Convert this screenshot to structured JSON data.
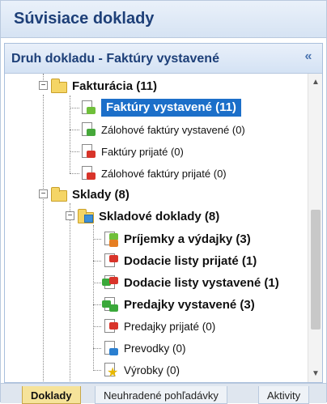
{
  "panel": {
    "title": "Súvisiace doklady"
  },
  "group": {
    "label": "Druh dokladu - Faktúry vystavené",
    "collapse_icon": "«"
  },
  "tree": {
    "fakturacia": {
      "label": "Fakturácia (11)",
      "items": [
        {
          "label": "Faktúry vystavené (11)",
          "selected": true
        },
        {
          "label": "Zálohové faktúry vystavené (0)"
        },
        {
          "label": "Faktúry prijaté (0)"
        },
        {
          "label": "Zálohové faktúry prijaté (0)"
        }
      ]
    },
    "sklady": {
      "label": "Sklady (8)",
      "skladove": {
        "label": "Skladové doklady (8)",
        "items": [
          {
            "label": "Príjemky a výdajky (3)"
          },
          {
            "label": "Dodacie listy prijaté (1)"
          },
          {
            "label": "Dodacie listy vystavené (1)"
          },
          {
            "label": "Predajky vystavené (3)"
          },
          {
            "label": "Predajky prijaté (0)"
          },
          {
            "label": "Prevodky (0)"
          },
          {
            "label": "Výrobky (0)"
          }
        ]
      }
    }
  },
  "scrollbar": {
    "up": "▲",
    "down": "▼"
  },
  "tabs": [
    {
      "label": "Doklady",
      "active": true
    },
    {
      "label": "Neuhradené pohľadávky"
    },
    {
      "label": "Aktivity"
    }
  ],
  "colors": {
    "selection": "#1c6fc9",
    "title": "#1d3f78",
    "active_tab": "#f6e39a"
  }
}
